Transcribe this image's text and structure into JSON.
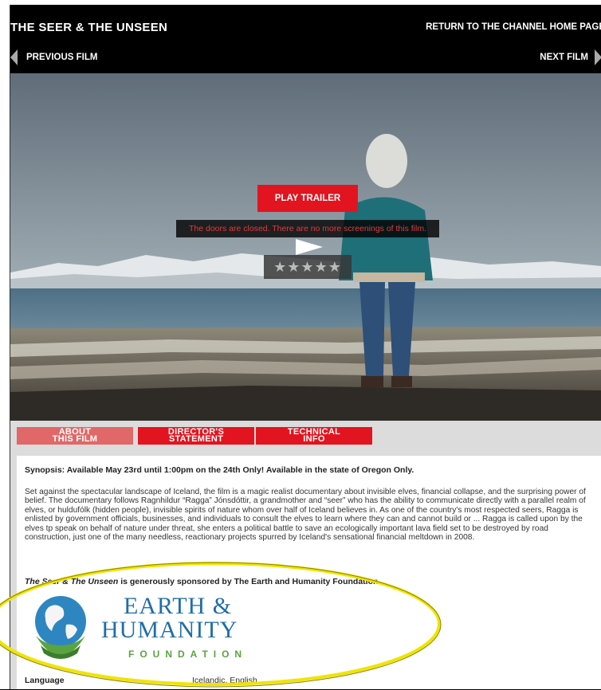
{
  "header": {
    "title": "THE SEER & THE UNSEEN",
    "return_link": "RETURN TO THE CHANNEL HOME PAGE",
    "previous_film": "PREVIOUS FILM",
    "next_film": "NEXT FILM"
  },
  "player": {
    "play_trailer_label": "PLAY TRAILER",
    "closed_message": "The doors are closed. There are no more screenings of this film.",
    "rating_stars": "★★★★★",
    "rating_value": 0,
    "rating_max": 5
  },
  "tabs": [
    {
      "label_line1": "ABOUT",
      "label_line2": "THIS FILM",
      "active": true
    },
    {
      "label_line1": "DIRECTOR'S",
      "label_line2": "STATEMENT",
      "active": false
    },
    {
      "label_line1": "TECHNICAL",
      "label_line2": "INFO",
      "active": false
    }
  ],
  "content": {
    "synopsis_heading": "Synopsis: Available May 23rd until 1:00pm on the 24th Only! Available in the state of Oregon Only.",
    "synopsis_body": "Set against the spectacular landscape of Iceland, the film is a magic realist documentary about invisible elves, financial collapse, and the surprising power of belief. The documentary follows Ragnhildur “Ragga” Jónsdóttir, a grandmother and “seer” who has the ability to communicate directly with a parallel realm of elves, or huldufólk (hidden people), invisible spirits of nature whom over half of Iceland believes in. As one of the country's most respected seers, Ragga is enlisted by government officials, businesses, and individuals to consult the elves to learn where they can and cannot build or ... Ragga is called upon by the elves tp speak on behalf of nature under threat, she enters a political battle to save an ecologically important lava field set to be destroyed by road construction, just one of the many needless, reactionary projects spurred by Iceland's sensational financial meltdown in 2008.",
    "sponsor_title": "The Seer & The Unseen",
    "sponsor_text": " is generously sponsored by The Earth and Humanity Foundation.",
    "logo": {
      "line1": "EARTH &",
      "line2": "HUMANITY",
      "line3": "FOUNDATION"
    },
    "language_label": "Language",
    "language_value": "Icelandic, English"
  },
  "colors": {
    "accent_red": "#e2141f",
    "active_tab": "#e06868",
    "highlight_ellipse": "#f0e400",
    "logo_blue": "#1f6ea8",
    "logo_green": "#5aa341"
  },
  "icons": [
    "previous-arrow-icon",
    "next-arrow-icon",
    "play-icon",
    "globe-hands-icon"
  ]
}
